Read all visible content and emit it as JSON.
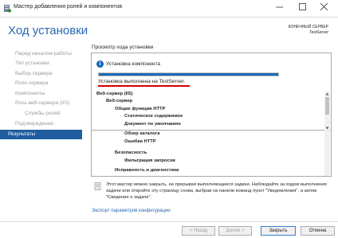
{
  "window": {
    "title": "Мастер добавления ролей и компонентов",
    "icon": "server-manager-icon"
  },
  "header": {
    "heading": "Ход установки",
    "destination_label": "КОНЕЧНЫЙ СЕРВЕР",
    "destination_server": "TestServer"
  },
  "nav": {
    "items": [
      {
        "label": "Перед началом работы",
        "level": 0,
        "active": false
      },
      {
        "label": "Тип установки",
        "level": 0,
        "active": false
      },
      {
        "label": "Выбор сервера",
        "level": 0,
        "active": false
      },
      {
        "label": "Роли сервера",
        "level": 0,
        "active": false
      },
      {
        "label": "Компоненты",
        "level": 0,
        "active": false
      },
      {
        "label": "Роль веб-сервера (IIS)",
        "level": 0,
        "active": false
      },
      {
        "label": "Службы ролей",
        "level": 1,
        "active": false
      },
      {
        "label": "Подтверждение",
        "level": 0,
        "active": false
      },
      {
        "label": "Результаты",
        "level": 0,
        "active": true
      }
    ]
  },
  "main": {
    "section_label": "Просмотр хода установки",
    "install_label": "Установка компонента",
    "progress_fraction": 1.0,
    "success_text": "Установка выполнена на TestServer.",
    "features": [
      {
        "label": "Веб-сервер (IIS)",
        "level": 0
      },
      {
        "label": "Веб-сервер",
        "level": 1
      },
      {
        "label": "Общие функции HTTP",
        "level": 2
      },
      {
        "label": "Статическое содержимое",
        "level": 3
      },
      {
        "label": "Документ по умолчанию",
        "level": 3
      },
      {
        "label": "Обзор каталога",
        "level": 3
      },
      {
        "label": "Ошибки HTTP",
        "level": 3
      },
      {
        "label": "Безопасность",
        "level": 2
      },
      {
        "label": "Фильтрация запросов",
        "level": 3
      },
      {
        "label": "Исправность и диагностика",
        "level": 2
      }
    ],
    "note": "Этот мастер можно закрыть, не прерывая выполняющиеся задачи. Наблюдайте за ходом выполнения задачи или откройте эту страницу снова, выбрав на панели команд пункт \"Уведомления\", а затем \"Сведения о задаче\".",
    "export_link": "Экспорт параметров конфигурации"
  },
  "footer": {
    "back_label": "< Назад",
    "next_label": "Далее >",
    "finish_label": "Закрыть",
    "cancel_label": "Отмена"
  },
  "colors": {
    "accent": "#2a67b1",
    "nav_active": "#1f5d9f",
    "progress": "#1b6bb8",
    "underline": "#d20000"
  }
}
